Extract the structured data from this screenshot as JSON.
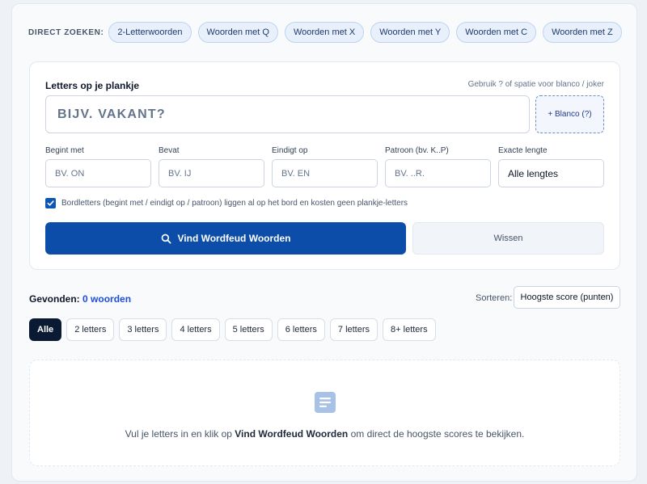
{
  "quick_search": {
    "label": "DIRECT ZOEKEN:",
    "chips": [
      "2-Letterwoorden",
      "Woorden met Q",
      "Woorden met X",
      "Woorden met Y",
      "Woorden met C",
      "Woorden met Z"
    ]
  },
  "form": {
    "label": "Letters op je plankje",
    "hint": "Gebruik ? of spatie voor blanco / joker",
    "letters_placeholder": "BIJV. VAKANT?",
    "blank_button": "+ Blanco (?)",
    "fields": [
      {
        "label": "Begint met",
        "placeholder": "BV. ON"
      },
      {
        "label": "Bevat",
        "placeholder": "BV. IJ"
      },
      {
        "label": "Eindigt op",
        "placeholder": "BV. EN"
      },
      {
        "label": "Patroon (bv. K..P)",
        "placeholder": "BV. ..R."
      }
    ],
    "length": {
      "label": "Exacte lengte",
      "value": "Alle lengtes"
    },
    "board_letters_checkbox": "Bordletters (begint met / eindigt op / patroon) liggen al op het bord en kosten geen plankje-letters",
    "search_button": "Vind Wordfeud Woorden",
    "clear_button": "Wissen"
  },
  "results": {
    "found_label": "Gevonden:",
    "found_count": "0 woorden",
    "sort_label": "Sorteren:",
    "sort_value": "Hoogste score (punten)",
    "filters": [
      "Alle",
      "2 letters",
      "3 letters",
      "4 letters",
      "5 letters",
      "6 letters",
      "7 letters",
      "8+ letters"
    ],
    "active_filter": "Alle",
    "empty_before": "Vul je letters in en klik op ",
    "empty_bold": "Vind Wordfeud Woorden",
    "empty_after": " om direct de hoogste scores te bekijken."
  },
  "colors": {
    "primary": "#0b4da8",
    "chip_bg": "#e8f0fb",
    "active_filter": "#0b1a33",
    "count": "#1d4ed8"
  },
  "icons": {
    "search": "search-icon",
    "document": "document-icon",
    "check": "check-icon"
  }
}
